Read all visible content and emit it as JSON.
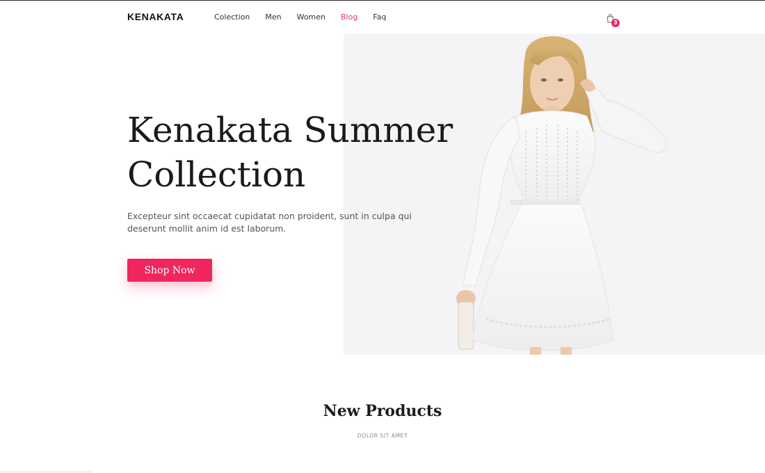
{
  "brand": {
    "logo": "KENAKATA"
  },
  "nav": {
    "items": [
      {
        "label": "Colection"
      },
      {
        "label": "Men"
      },
      {
        "label": "Women"
      },
      {
        "label": "Blog",
        "active": true
      },
      {
        "label": "Faq"
      }
    ]
  },
  "cart": {
    "icon": "shopping-bag-icon",
    "count": "3"
  },
  "hero": {
    "title_line1": "Kenakata Summer",
    "title_line2": "Collection",
    "text": "Excepteur sint occaecat cupidatat non proident, sunt in culpa qui deserunt mollit anim id est laborum.",
    "button_label": "Shop Now",
    "image": "model-in-white-lace-dress"
  },
  "new_products": {
    "title": "New Products",
    "subtitle": "DOLOR SIT AMET"
  },
  "colors": {
    "accent": "#f0265e",
    "active_nav": "#e8336b",
    "hero_bg": "#f4f3f5",
    "text_dark": "#1a1a1a"
  }
}
